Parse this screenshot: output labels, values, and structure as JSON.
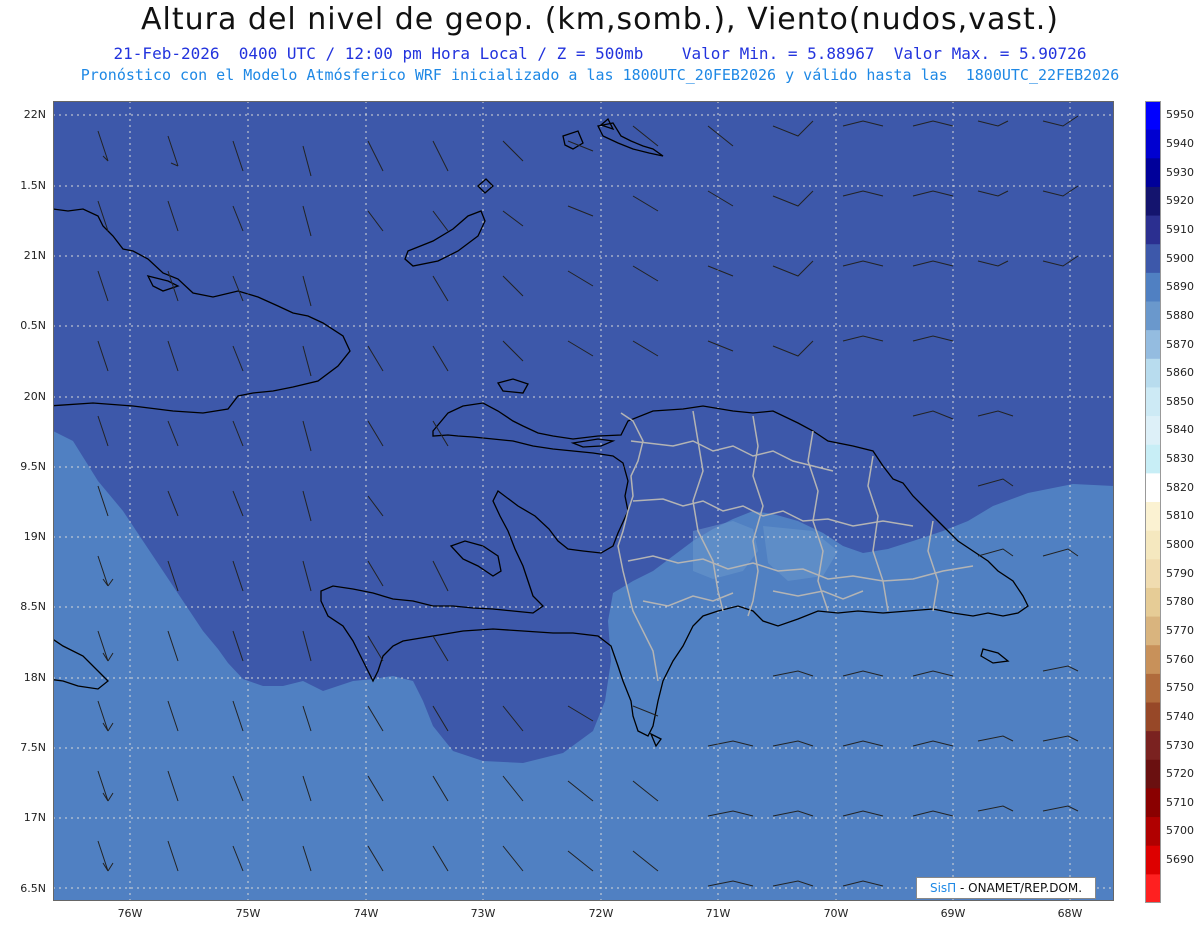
{
  "header": {
    "title": "Altura del nivel de geop. (km,somb.), Viento(nudos,vast.)",
    "line1": "21-Feb-2026  0400 UTC / 12:00 pm Hora Local / Z = 500mb    Valor Min. = 5.88967  Valor Max. = 5.90726",
    "line2": "Pronóstico con el Modelo Atmósferico WRF inicializado a las 1800UTC_20FEB2026 y válido hasta las  1800UTC_22FEB2026"
  },
  "axes": {
    "lat_labels": [
      "22N",
      "1.5N",
      "21N",
      "0.5N",
      "20N",
      "9.5N",
      "19N",
      "8.5N",
      "18N",
      "7.5N",
      "17N",
      "6.5N"
    ],
    "lon_labels": [
      "76W",
      "75W",
      "74W",
      "73W",
      "72W",
      "71W",
      "70W",
      "69W",
      "68W"
    ]
  },
  "colors": {
    "field_5890": "#5080c2",
    "field_5900": "#3d58aa",
    "field_5880": "#6a98cc",
    "coast": "#000000",
    "borders": "#b4b4b4",
    "grid": "#d8d8d8"
  },
  "colorbar": {
    "levels": [
      {
        "label": "5950",
        "color": "#0000ff"
      },
      {
        "label": "5940",
        "color": "#0000d0"
      },
      {
        "label": "5930",
        "color": "#00009a"
      },
      {
        "label": "5920",
        "color": "#14146e"
      },
      {
        "label": "5910",
        "color": "#2b2f90"
      },
      {
        "label": "5900",
        "color": "#3d58aa"
      },
      {
        "label": "5890",
        "color": "#5080c2"
      },
      {
        "label": "5880",
        "color": "#6a98cc"
      },
      {
        "label": "5870",
        "color": "#94bce0"
      },
      {
        "label": "5860",
        "color": "#b8dcee"
      },
      {
        "label": "5850",
        "color": "#cdeaf5"
      },
      {
        "label": "5840",
        "color": "#ddf0f8"
      },
      {
        "label": "5830",
        "color": "#c8eef6"
      },
      {
        "label": "5820",
        "color": "#ffffff"
      },
      {
        "label": "5810",
        "color": "#fbf2d2"
      },
      {
        "label": "5800",
        "color": "#f5e8bf"
      },
      {
        "label": "5790",
        "color": "#f0dcb0"
      },
      {
        "label": "5780",
        "color": "#e6cc96"
      },
      {
        "label": "5770",
        "color": "#d9b47e"
      },
      {
        "label": "5760",
        "color": "#c8915a"
      },
      {
        "label": "5750",
        "color": "#b06b3c"
      },
      {
        "label": "5740",
        "color": "#974828"
      },
      {
        "label": "5730",
        "color": "#7a2220"
      },
      {
        "label": "5720",
        "color": "#6a1010"
      },
      {
        "label": "5710",
        "color": "#8a0000"
      },
      {
        "label": "5700",
        "color": "#b00000"
      },
      {
        "label": "5690",
        "color": "#dd0000"
      },
      {
        "label": "",
        "color": "#ff2020"
      }
    ]
  },
  "credit": {
    "brand": "SisΠ",
    "text": " - ONAMET/REP.DOM."
  }
}
